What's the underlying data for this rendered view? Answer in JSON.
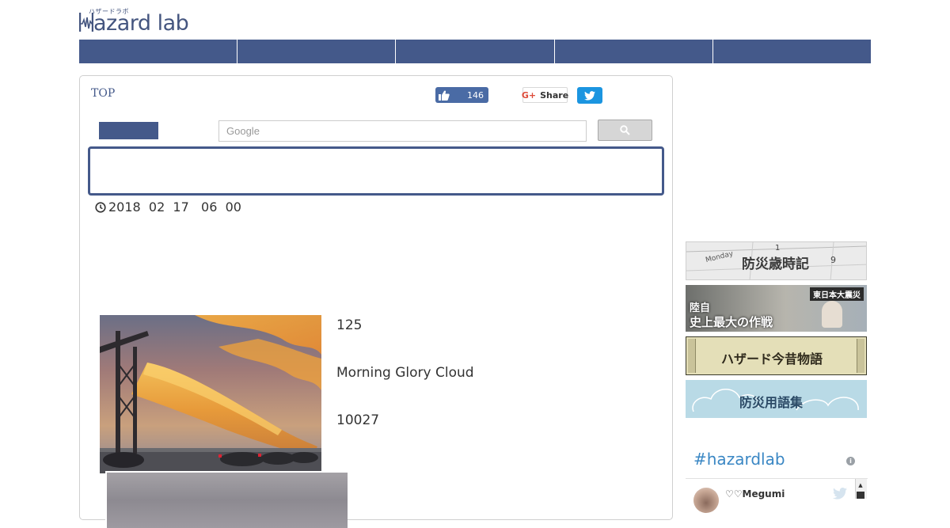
{
  "logo": {
    "kana": "ハザードラボ",
    "word": "azard lab"
  },
  "navbar": {
    "items": [
      "",
      "",
      "",
      "",
      ""
    ]
  },
  "breadcrumb": "TOP",
  "social": {
    "like_count": "146",
    "share_label": "Share",
    "gplus_mark": "G+",
    "like_icon": "thumbs-up-icon",
    "twitter_icon": "twitter-bird-icon"
  },
  "search": {
    "placeholder": "Google",
    "button_icon": "magnifier-icon"
  },
  "article": {
    "date": "2018  02  17   06  00",
    "info_lines": [
      "125",
      "Morning Glory Cloud",
      "10027"
    ]
  },
  "sidebar": {
    "banners": [
      {
        "text": "防災歳時記",
        "sub": "Monday"
      },
      {
        "text_top": "陸自",
        "text_bottom": "史上最大の作戦",
        "tag": "東日本大震災"
      },
      {
        "text": "ハザード今昔物語"
      },
      {
        "text": "防災用語集"
      }
    ],
    "feed": {
      "title": "#hazardlab",
      "user": "♡♡Megumi"
    }
  },
  "colors": {
    "brand": "#44598a",
    "link": "#3a87c4",
    "twitter": "#1b95e0"
  }
}
